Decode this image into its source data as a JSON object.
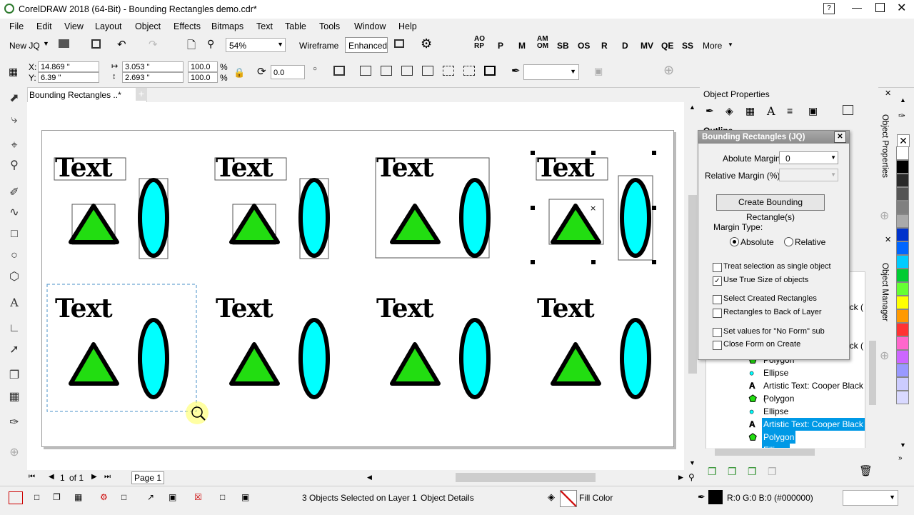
{
  "window": {
    "title": "CorelDRAW 2018 (64-Bit) - Bounding Rectangles demo.cdr*"
  },
  "menu": [
    "File",
    "Edit",
    "View",
    "Layout",
    "Object",
    "Effects",
    "Bitmaps",
    "Text",
    "Table",
    "Tools",
    "Window",
    "Help"
  ],
  "toolbar1": {
    "new_label": "New JQ",
    "zoom_value": "54%",
    "wireframe_label": "Wireframe",
    "enhanced_label": "Enhanced",
    "macros": [
      "AO RP",
      "P",
      "M",
      "AM OM",
      "SB",
      "OS",
      "R",
      "D",
      "MV",
      "QE",
      "SS"
    ],
    "more_label": "More"
  },
  "toolbar2": {
    "x_label": "X:",
    "x_value": "14.869 \"",
    "y_label": "Y:",
    "y_value": "6.39 \"",
    "w_value": "3.053 \"",
    "h_value": "2.693 \"",
    "sx_value": "100.0",
    "sy_value": "100.0",
    "pct": "%",
    "angle_value": "0.0"
  },
  "document": {
    "tab_label": "Bounding Rectangles ..*",
    "shape_text": "Text",
    "page_nav": "1",
    "page_of": "of 1",
    "page_tab": "Page 1"
  },
  "object_properties": {
    "title": "Object Properties",
    "section": "Outline",
    "side_tab": "Object Properties"
  },
  "object_manager": {
    "side_tab": "Object Manager",
    "rows": [
      {
        "label": "Polygon",
        "icon": "polygon-icon",
        "selected": false
      },
      {
        "label": "Ellipse",
        "icon": "ellipse-icon",
        "selected": false
      },
      {
        "label": "Artistic Text: Cooper Black (",
        "icon": "text-icon",
        "selected": false
      },
      {
        "label": "Polygon",
        "icon": "polygon-icon",
        "selected": false
      },
      {
        "label": "Ellipse",
        "icon": "ellipse-icon",
        "selected": false
      },
      {
        "label": "Artistic Text: Cooper Black (",
        "icon": "text-icon",
        "selected": true
      },
      {
        "label": "Polygon",
        "icon": "polygon-icon",
        "selected": true
      },
      {
        "label": "Ellipse",
        "icon": "ellipse-icon",
        "selected": true
      }
    ],
    "partial_right_1": "ack (",
    "partial_right_2": "ack ("
  },
  "dialog": {
    "title": "Bounding Rectangles (JQ)",
    "abs_margin_label": "Abolute Margin",
    "abs_margin_value": "0",
    "rel_margin_label": "Relative Margin (%)",
    "create_button": "Create Bounding Rectangle(s)",
    "margin_type_label": "Margin Type:",
    "radio_absolute": "Absolute",
    "radio_relative": "Relative",
    "checkboxes": [
      {
        "label": "Treat selection as single object",
        "checked": false
      },
      {
        "label": "Use True Size of objects",
        "checked": true
      },
      {
        "label": "Select Created Rectangles",
        "checked": false
      },
      {
        "label": "Rectangles to Back of Layer",
        "checked": false
      },
      {
        "label": "Set values for \"No Form\" sub",
        "checked": false
      },
      {
        "label": "Close Form on Create",
        "checked": false
      }
    ]
  },
  "status": {
    "selection": "3 Objects Selected on Layer 1",
    "details": "Object Details",
    "fill": "Fill Color",
    "outline": "R:0 G:0 B:0 (#000000)"
  },
  "colors": {
    "triangle": "#22dd11",
    "ellipse": "#00ffff",
    "selection_blue": "#0099e6",
    "palette": [
      "#ffffff",
      "#000000",
      "#2a2a2a",
      "#555555",
      "#808080",
      "#aaaaaa",
      "#0033cc",
      "#0066ff",
      "#00ccff",
      "#00cc33",
      "#66ff33",
      "#ffff00",
      "#ff9900",
      "#ff3333",
      "#ff66cc",
      "#cc66ff",
      "#9999ff",
      "#ccccff",
      "#d9d9ff"
    ]
  }
}
